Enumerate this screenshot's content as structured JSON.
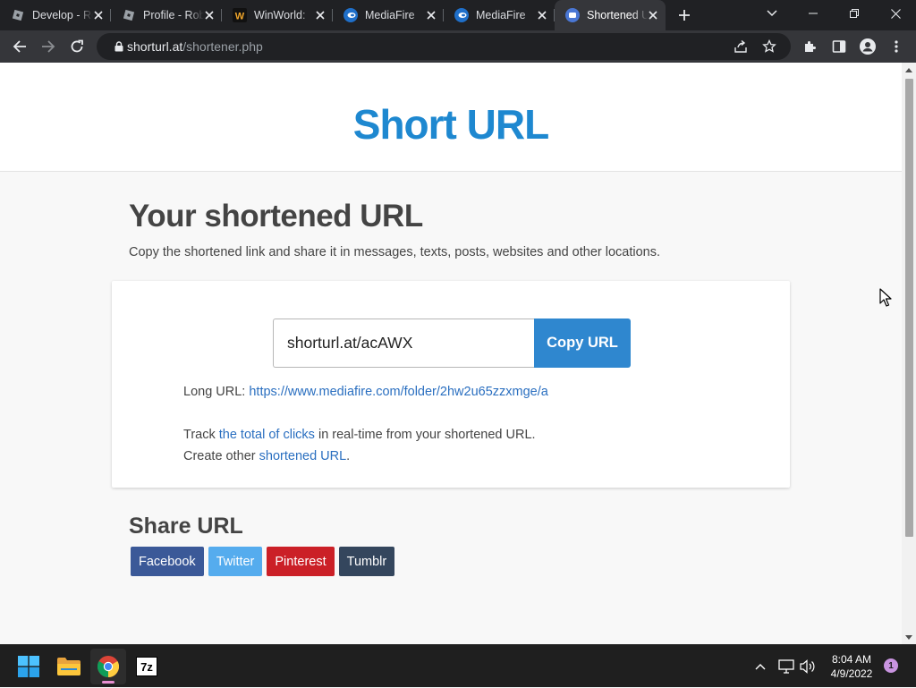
{
  "browser": {
    "tabs": [
      {
        "title": "Develop - Roblox",
        "favicon": "roblox-icon"
      },
      {
        "title": "Profile - Roblox",
        "favicon": "roblox-icon"
      },
      {
        "title": "WinWorld:",
        "favicon": "winworld-icon"
      },
      {
        "title": "MediaFire",
        "favicon": "mediafire-icon"
      },
      {
        "title": "MediaFire",
        "favicon": "mediafire-icon"
      },
      {
        "title": "Shortened URL",
        "favicon": "shorturl-icon",
        "active": true
      }
    ],
    "url": {
      "host": "shorturl.at",
      "path": "/shortener.php"
    }
  },
  "page": {
    "logo": "Short URL",
    "heading": "Your shortened URL",
    "subheading": "Copy the shortened link and share it in messages, texts, posts, websites and other locations.",
    "short_url": "shorturl.at/acAWX",
    "copy_button": "Copy URL",
    "long_url_label": "Long URL:",
    "long_url": "https://www.mediafire.com/folder/2hw2u65zzxmge/a",
    "track_prefix": "Track",
    "track_link": "the total of clicks",
    "track_suffix": "in real-time from your shortened URL.",
    "create_prefix": "Create other",
    "create_link": "shortened URL",
    "create_suffix": ".",
    "share_heading": "Share URL",
    "share_buttons": [
      {
        "label": "Facebook",
        "color": "#3b5998"
      },
      {
        "label": "Twitter",
        "color": "#55acee"
      },
      {
        "label": "Pinterest",
        "color": "#cb2027"
      },
      {
        "label": "Tumblr",
        "color": "#34465d"
      }
    ]
  },
  "colors": {
    "accent": "#2f87cf",
    "logo": "#1e88d0",
    "link": "#2a6fc0"
  },
  "taskbar": {
    "apps": [
      "windows-start-icon",
      "file-explorer-icon",
      "chrome-icon",
      "7zip-icon"
    ],
    "time": "8:04 AM",
    "date": "4/9/2022",
    "notifications": "1"
  }
}
